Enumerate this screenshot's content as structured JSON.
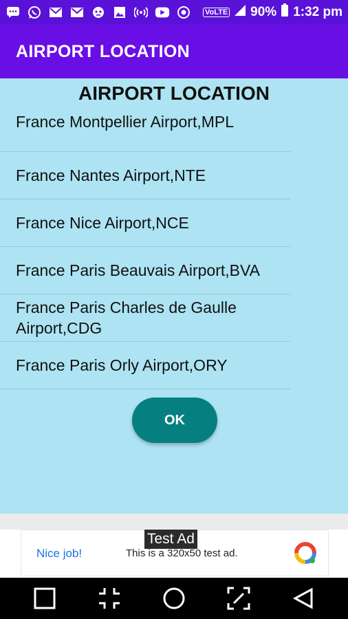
{
  "status_bar": {
    "icons": [
      "chat-icon",
      "whatsapp-icon",
      "gmail-icon",
      "gmail-icon",
      "bug-icon",
      "image-icon",
      "hotspot-icon",
      "youtube-icon",
      "vpn-icon"
    ],
    "volte": "VoLTE",
    "battery": "90%",
    "time": "1:32 pm"
  },
  "app_bar": {
    "title": "AIRPORT LOCATION"
  },
  "main": {
    "heading": "AIRPORT LOCATION",
    "airports": [
      "France Montpellier Airport,MPL",
      "France Nantes Airport,NTE",
      "France Nice Airport,NCE",
      "France Paris Beauvais Airport,BVA",
      "France Paris Charles de Gaulle Airport,CDG",
      "France Paris Orly Airport,ORY"
    ],
    "ok_label": "OK"
  },
  "ad": {
    "label": "Test Ad",
    "nice_text": "Nice job!",
    "body_text": "This is a 320x50 test ad."
  },
  "colors": {
    "status_bar": "#5a12d9",
    "app_bar": "#6a0ee6",
    "content_bg": "#ade3f2",
    "ok_button": "#067f80"
  }
}
